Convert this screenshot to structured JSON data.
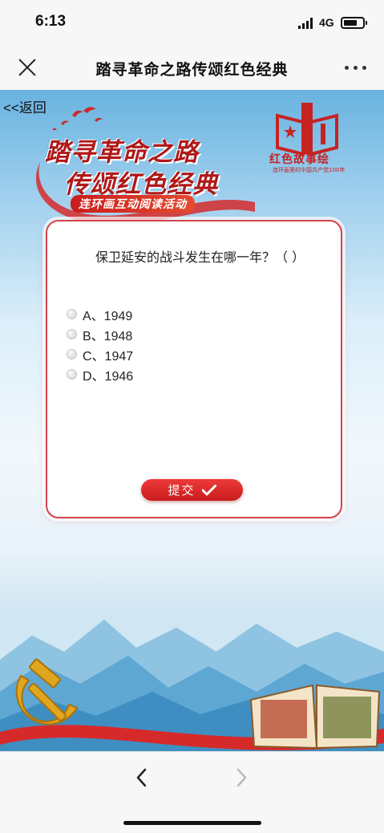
{
  "status": {
    "time": "6:13",
    "network": "4G"
  },
  "nav": {
    "title": "踏寻革命之路传颂红色经典"
  },
  "page": {
    "back_label": "<<返回",
    "banner_line1": "踏寻革命之路",
    "banner_line2": "传颂红色经典",
    "banner_sub": "连环画互动阅读活动",
    "logo_name": "红色故事绘",
    "logo_slogan": "连环画里的中国共产党100年"
  },
  "quiz": {
    "question": "保卫延安的战斗发生在哪一年？（ ）",
    "options": [
      "A、1949",
      "B、1948",
      "C、1947",
      "D、1946"
    ],
    "submit_label": "提交"
  },
  "colors": {
    "accent": "#c81d1d",
    "card_border": "#d4444d",
    "sky": "#69b3e0"
  }
}
